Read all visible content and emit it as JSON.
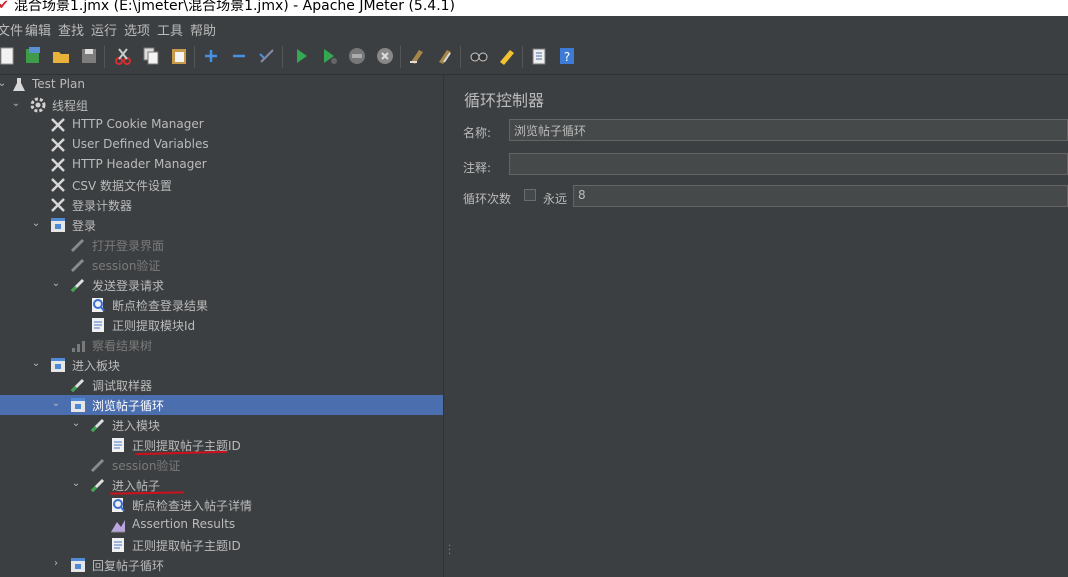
{
  "window": {
    "title": "混合场景1.jmx (E:\\jmeter\\混合场景1.jmx) - Apache JMeter (5.4.1)"
  },
  "menu": [
    "文件",
    "编辑",
    "查找",
    "运行",
    "选项",
    "工具",
    "帮助"
  ],
  "toolbar": {
    "buttons": [
      "new-icon",
      "templates-icon",
      "open-icon",
      "save-icon",
      "cut-icon",
      "copy-icon",
      "paste-icon",
      "expand-icon",
      "collapse-icon",
      "toggle-icon",
      "start-icon",
      "start-no-pause-icon",
      "stop-icon",
      "shutdown-icon",
      "clear-icon",
      "clear-all-icon",
      "search-icon",
      "reset-search-icon",
      "function-helper-icon",
      "help-icon"
    ]
  },
  "tree": {
    "items": [
      {
        "label": "Test Plan",
        "icon": "flask-icon",
        "disabled": false,
        "expanded": true
      },
      {
        "label": "线程组",
        "icon": "gear-icon",
        "disabled": false,
        "expanded": true
      },
      {
        "label": "HTTP Cookie Manager",
        "icon": "wrench-icon",
        "disabled": false
      },
      {
        "label": "User Defined Variables",
        "icon": "wrench-icon",
        "disabled": false
      },
      {
        "label": "HTTP Header Manager",
        "icon": "wrench-icon",
        "disabled": false
      },
      {
        "label": "CSV 数据文件设置",
        "icon": "wrench-icon",
        "disabled": false
      },
      {
        "label": "登录计数器",
        "icon": "wrench-icon",
        "disabled": false
      },
      {
        "label": "登录",
        "icon": "controller-icon",
        "disabled": false,
        "expanded": true
      },
      {
        "label": "打开登录界面",
        "icon": "pipette-icon",
        "disabled": true
      },
      {
        "label": "session验证",
        "icon": "pipette-icon",
        "disabled": true
      },
      {
        "label": "发送登录请求",
        "icon": "pipette-icon",
        "disabled": false,
        "expanded": true
      },
      {
        "label": "断点检查登录结果",
        "icon": "magnifier-icon",
        "disabled": false
      },
      {
        "label": "正则提取模块Id",
        "icon": "document-icon",
        "disabled": false
      },
      {
        "label": "察看结果树",
        "icon": "chart-icon",
        "disabled": true
      },
      {
        "label": "进入板块",
        "icon": "controller-icon",
        "disabled": false,
        "expanded": true
      },
      {
        "label": "调试取样器",
        "icon": "pipette-icon",
        "disabled": false
      },
      {
        "label": "浏览帖子循环",
        "icon": "controller-icon",
        "disabled": false,
        "expanded": true,
        "selected": true
      },
      {
        "label": "进入模块",
        "icon": "pipette-icon",
        "disabled": false,
        "expanded": true
      },
      {
        "label": "正则提取帖子主题ID",
        "icon": "document-icon",
        "disabled": false
      },
      {
        "label": "session验证",
        "icon": "pipette-icon",
        "disabled": true
      },
      {
        "label": "进入帖子",
        "icon": "pipette-icon",
        "disabled": false,
        "expanded": true
      },
      {
        "label": "断点检查进入帖子详情",
        "icon": "magnifier-icon",
        "disabled": false
      },
      {
        "label": "Assertion Results",
        "icon": "chart-icon",
        "disabled": false
      },
      {
        "label": "正则提取帖子主题ID",
        "icon": "document-icon",
        "disabled": false
      },
      {
        "label": "回复帖子循环",
        "icon": "controller-icon",
        "disabled": false,
        "expanded": false
      }
    ]
  },
  "panel": {
    "title": "循环控制器",
    "name_label": "名称:",
    "name_value": "浏览帖子循环",
    "comment_label": "注释:",
    "comment_value": "",
    "loop_label": "循环次数",
    "forever_label": "永远",
    "forever_checked": false,
    "loop_value": "8"
  }
}
